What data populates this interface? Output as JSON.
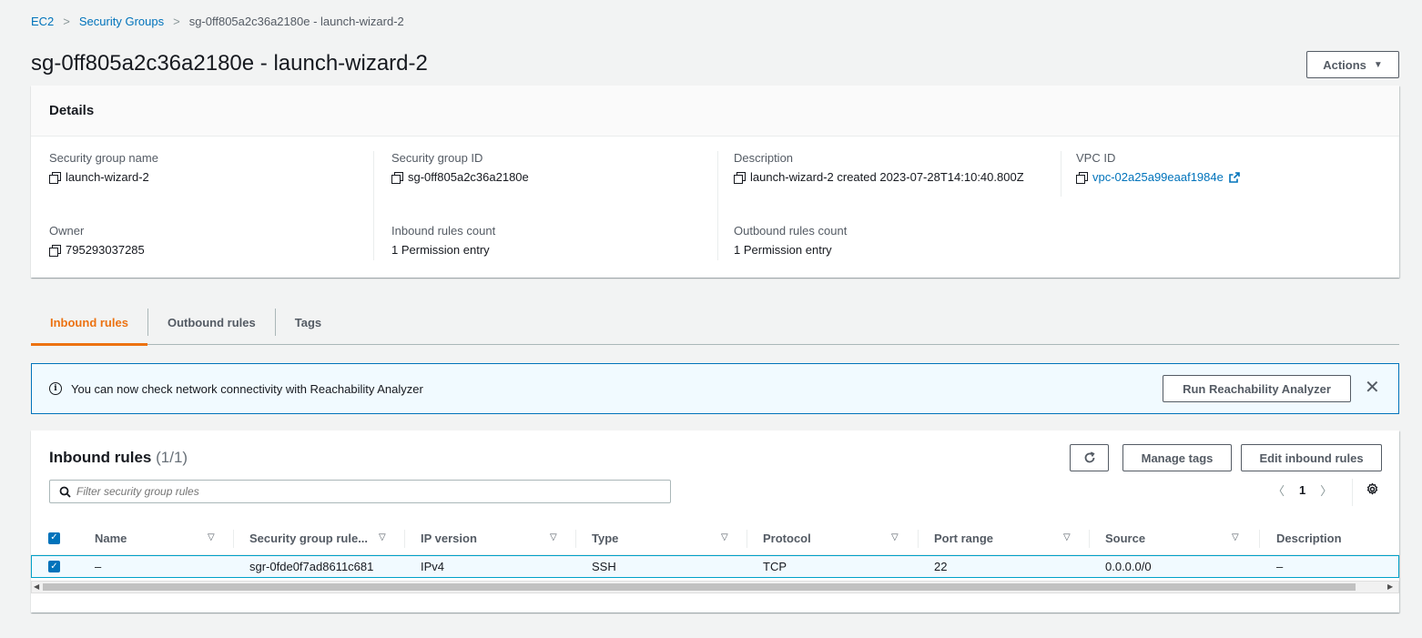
{
  "breadcrumb": {
    "items": [
      "EC2",
      "Security Groups"
    ],
    "current": "sg-0ff805a2c36a2180e - launch-wizard-2"
  },
  "page_title": "sg-0ff805a2c36a2180e - launch-wizard-2",
  "actions_label": "Actions",
  "details": {
    "header": "Details",
    "sg_name_label": "Security group name",
    "sg_name": "launch-wizard-2",
    "sg_id_label": "Security group ID",
    "sg_id": "sg-0ff805a2c36a2180e",
    "description_label": "Description",
    "description": "launch-wizard-2 created 2023-07-28T14:10:40.800Z",
    "vpc_label": "VPC ID",
    "vpc_id": "vpc-02a25a99eaaf1984e",
    "owner_label": "Owner",
    "owner": "795293037285",
    "inbound_count_label": "Inbound rules count",
    "inbound_count": "1 Permission entry",
    "outbound_count_label": "Outbound rules count",
    "outbound_count": "1 Permission entry"
  },
  "tabs": [
    {
      "label": "Inbound rules",
      "active": true
    },
    {
      "label": "Outbound rules",
      "active": false
    },
    {
      "label": "Tags",
      "active": false
    }
  ],
  "banner": {
    "text": "You can now check network connectivity with Reachability Analyzer",
    "button": "Run Reachability Analyzer"
  },
  "rules": {
    "title": "Inbound rules",
    "count": "(1/1)",
    "manage_tags": "Manage tags",
    "edit_rules": "Edit inbound rules",
    "filter_placeholder": "Filter security group rules",
    "page": "1",
    "columns": [
      "Name",
      "Security group rule...",
      "IP version",
      "Type",
      "Protocol",
      "Port range",
      "Source",
      "Description"
    ],
    "rows": [
      {
        "name": "–",
        "rule_id": "sgr-0fde0f7ad8611c681",
        "ip_version": "IPv4",
        "type": "SSH",
        "protocol": "TCP",
        "port_range": "22",
        "source": "0.0.0.0/0",
        "description": "–"
      }
    ]
  },
  "colors": {
    "link": "#0073bb",
    "active_tab": "#ec7211",
    "banner_bg": "#f1faff"
  }
}
